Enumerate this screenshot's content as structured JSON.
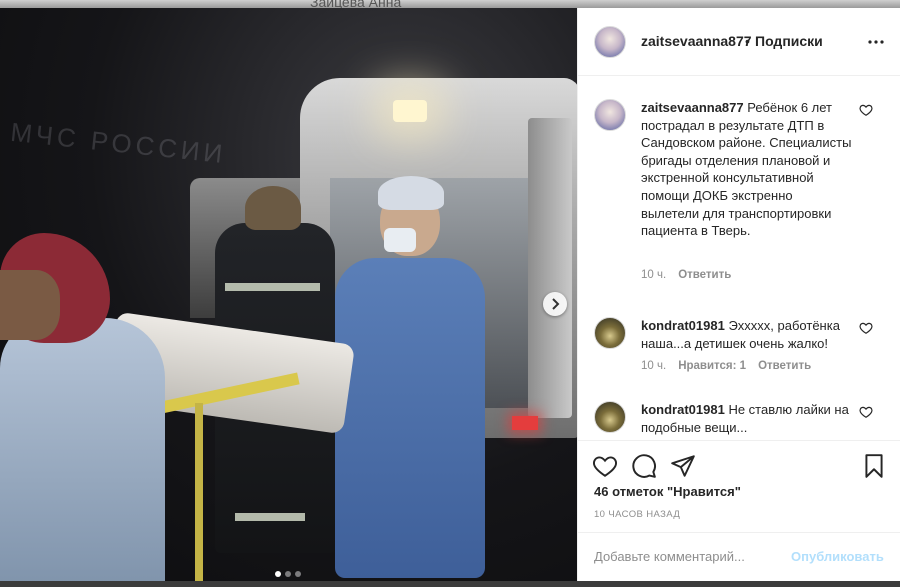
{
  "backdrop": {
    "name": "Зайцева Анна"
  },
  "photo": {
    "watermark": "МЧС РОССИИ",
    "carousel_dots": 3,
    "active_dot": 0
  },
  "post": {
    "username": "zaitsevaanna877",
    "separator": "•",
    "follow_label": "Подписки",
    "caption": {
      "username": "zaitsevaanna877",
      "text": "Ребёнок 6 лет пострадал в результате ДТП в Сандовском районе. Специалисты бригады отделения плановой и экстренной консультативной помощи ДОКБ экстренно вылетели для транспортировки пациента в Тверь.",
      "time": "10 ч.",
      "reply_label": "Ответить"
    },
    "comments": [
      {
        "username": "kondrat01981",
        "text": "Эхxxxx, работёнка наша...а детишек очень жалко!",
        "time": "10 ч.",
        "likes_label": "Нравится: 1",
        "reply_label": "Ответить"
      },
      {
        "username": "kondrat01981",
        "text": "Не ставлю лайки на подобные вещи..."
      }
    ],
    "likes_text": "46 отметок \"Нравится\"",
    "posted_ago": "10 часов назад",
    "comment_placeholder": "Добавьте комментарий...",
    "publish_label": "Опубликовать"
  },
  "colors": {
    "text": "#262626",
    "muted": "#8e8e8e",
    "publish_disabled": "#b2dffc",
    "border": "#efefef"
  },
  "icons": [
    "more-icon",
    "heart-icon",
    "comment-icon",
    "share-icon",
    "bookmark-icon",
    "chevron-right-icon"
  ]
}
